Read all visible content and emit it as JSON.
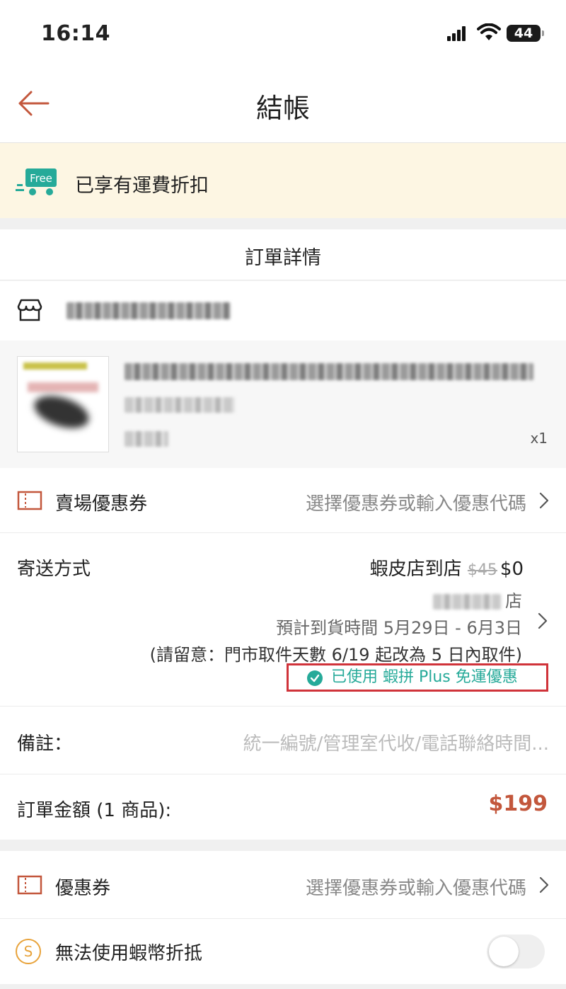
{
  "status_bar": {
    "time": "16:14",
    "battery": "44"
  },
  "header": {
    "title": "結帳"
  },
  "shipping_banner": {
    "icon_label": "Free",
    "text": "已享有運費折扣"
  },
  "order": {
    "section_title": "訂單詳情",
    "product": {
      "quantity": "x1"
    }
  },
  "shop_coupon": {
    "label": "賣場優惠券",
    "hint": "選擇優惠券或輸入優惠代碼"
  },
  "shipping": {
    "label": "寄送方式",
    "method": "蝦皮店到店",
    "original_fee": "$45",
    "fee": "$0",
    "store_suffix": "店",
    "eta": "預計到貨時間 5月29日 - 6月3日",
    "notice": "(請留意：門市取件天數 6/19 起改為 5 日內取件)",
    "plus_badge": "已使用 蝦拼 Plus 免運優惠"
  },
  "notes": {
    "label": "備註：",
    "placeholder": "統一編號/管理室代收/電話聯絡時間..."
  },
  "total": {
    "label": "訂單金額 (1 商品):",
    "amount": "$199"
  },
  "platform_coupon": {
    "label": "優惠券",
    "hint": "選擇優惠券或輸入優惠代碼"
  },
  "coins": {
    "icon_label": "S",
    "label": "無法使用蝦幣折抵",
    "enabled": false
  },
  "colors": {
    "accent": "#c3573c",
    "teal": "#26aa99",
    "banner_bg": "#fdf6e3",
    "highlight_border": "#d0333a"
  }
}
